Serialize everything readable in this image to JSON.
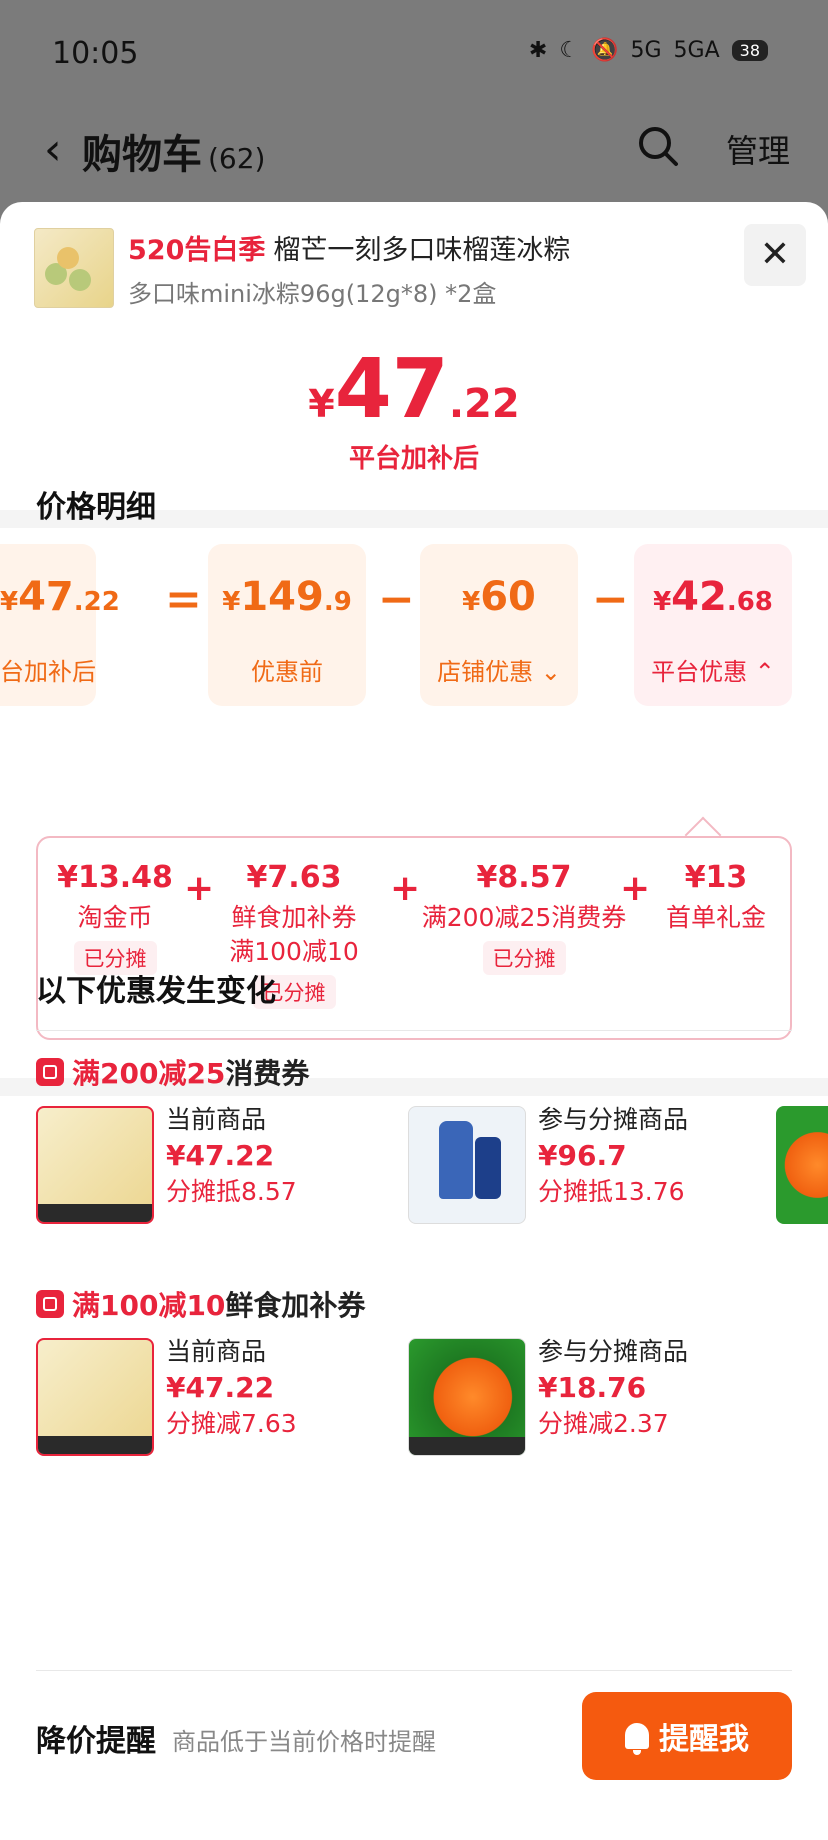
{
  "status": {
    "time": "10:05",
    "net1": "5G",
    "net2": "5GA",
    "battery": "38"
  },
  "header": {
    "back": "‹",
    "title": "购物车",
    "count": "(62)",
    "manage": "管理"
  },
  "product": {
    "tag": "520告白季",
    "name": "榴芒一刻多口味榴莲冰粽",
    "spec": "多口味mini冰粽96g(12g*8) *2盒"
  },
  "final_price": {
    "yen": "¥",
    "int": "47",
    "dec": ".22",
    "label": "平台加补后"
  },
  "breakdown": {
    "title": "价格明细",
    "cards": [
      {
        "yen": "¥",
        "int": "47",
        "dec": ".22",
        "label": "台加补后"
      },
      {
        "yen": "¥",
        "int": "149",
        "dec": ".9",
        "label": "优惠前"
      },
      {
        "yen": "¥",
        "int": "60",
        "dec": "",
        "label": "店铺优惠 ⌄"
      },
      {
        "yen": "¥",
        "int": "42",
        "dec": ".68",
        "label": "平台优惠 ⌃"
      }
    ],
    "ops": [
      "=",
      "−",
      "−"
    ]
  },
  "platform_detail": {
    "items": [
      {
        "value": "¥13.48",
        "name": "淘金币",
        "chip": "已分摊"
      },
      {
        "value": "¥7.63",
        "name": "鲜食加补券\n满100减10",
        "chip": "已分摊"
      },
      {
        "value": "¥8.57",
        "name": "满200减25消费券",
        "chip": "已分摊"
      },
      {
        "value": "¥13",
        "name": "首单礼金",
        "chip": ""
      }
    ],
    "plus": "+"
  },
  "changes": {
    "title": "以下优惠发生变化",
    "groups": [
      {
        "head_red": "满200减25",
        "head_rest": "消费券",
        "products": [
          {
            "kind": "当前商品",
            "price": "¥47.22",
            "sub": "分摊抵8.57"
          },
          {
            "kind": "参与分摊商品",
            "price": "¥96.7",
            "sub": "分摊抵13.76"
          }
        ]
      },
      {
        "head_red": "满100减10",
        "head_rest": "鲜食加补券",
        "products": [
          {
            "kind": "当前商品",
            "price": "¥47.22",
            "sub": "分摊减7.63"
          },
          {
            "kind": "参与分摊商品",
            "price": "¥18.76",
            "sub": "分摊减2.37"
          }
        ]
      }
    ]
  },
  "remind": {
    "title": "降价提醒",
    "desc": "商品低于当前价格时提醒",
    "button": "提醒我"
  },
  "colors": {
    "red": "#e8243c",
    "orange": "#f06a16",
    "button": "#f55a0f"
  }
}
